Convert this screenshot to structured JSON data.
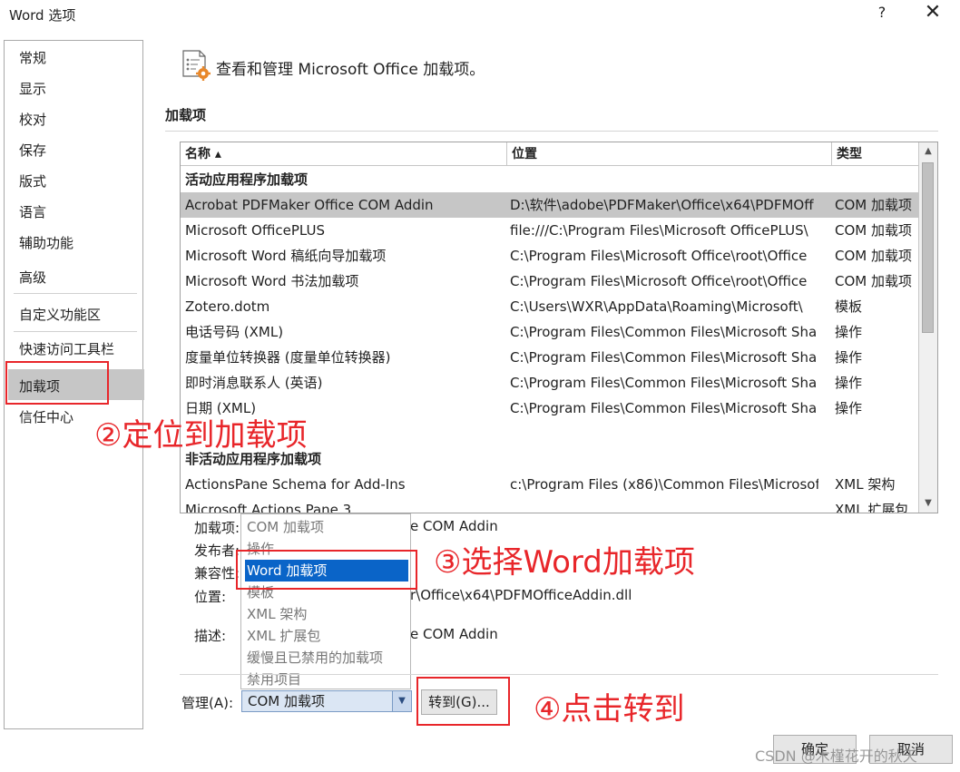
{
  "window": {
    "title": "Word 选项",
    "help": "?",
    "close": "✕"
  },
  "sidebar": {
    "items": [
      "常规",
      "显示",
      "校对",
      "保存",
      "版式",
      "语言",
      "辅助功能",
      "高级",
      "自定义功能区",
      "快速访问工具栏",
      "加载项",
      "信任中心"
    ],
    "selected": "加载项"
  },
  "header": {
    "text": "查看和管理 Microsoft Office 加载项。",
    "icon": "addin-gear-icon"
  },
  "section": {
    "label": "加载项"
  },
  "table": {
    "columns": [
      "名称 ▴",
      "位置",
      "类型"
    ],
    "groups": {
      "active": "活动应用程序加载项",
      "inactive": "非活动应用程序加载项"
    },
    "active_rows": [
      {
        "name": "Acrobat PDFMaker Office COM Addin",
        "location": "D:\\软件\\adobe\\PDFMaker\\Office\\x64\\PDFMOff",
        "type": "COM 加载项"
      },
      {
        "name": "Microsoft OfficePLUS",
        "location": "file:///C:\\Program Files\\Microsoft OfficePLUS\\",
        "type": "COM 加载项"
      },
      {
        "name": "Microsoft Word 稿纸向导加载项",
        "location": "C:\\Program Files\\Microsoft Office\\root\\Office",
        "type": "COM 加载项"
      },
      {
        "name": "Microsoft Word 书法加载项",
        "location": "C:\\Program Files\\Microsoft Office\\root\\Office",
        "type": "COM 加载项"
      },
      {
        "name": "Zotero.dotm",
        "location": "C:\\Users\\WXR\\AppData\\Roaming\\Microsoft\\",
        "type": "模板"
      },
      {
        "name": "电话号码 (XML)",
        "location": "C:\\Program Files\\Common Files\\Microsoft Sha",
        "type": "操作"
      },
      {
        "name": "度量单位转换器 (度量单位转换器)",
        "location": "C:\\Program Files\\Common Files\\Microsoft Sha",
        "type": "操作"
      },
      {
        "name": "即时消息联系人 (英语)",
        "location": "C:\\Program Files\\Common Files\\Microsoft Sha",
        "type": "操作"
      },
      {
        "name": "日期 (XML)",
        "location": "C:\\Program Files\\Common Files\\Microsoft Sha",
        "type": "操作"
      }
    ],
    "inactive_rows": [
      {
        "name": "ActionsPane Schema for Add-Ins",
        "location": "c:\\Program Files (x86)\\Common Files\\Microsof",
        "type": "XML 架构"
      },
      {
        "name": "Microsoft Actions Pane 3",
        "location": "",
        "type": "XML 扩展包"
      }
    ]
  },
  "details": {
    "addin_label": "加载项:",
    "addin_value": "e COM Addin",
    "publisher_label": "发布者:",
    "compat_label": "兼容性:",
    "location_label": "位置:",
    "location_value": "r\\Office\\x64\\PDFMOfficeAddin.dll",
    "desc_label": "描述:",
    "desc_value": "e COM Addin"
  },
  "dropdown": {
    "options": [
      "COM 加载项",
      "操作",
      "Word 加载项",
      "模板",
      "XML 架构",
      "XML 扩展包",
      "缓慢且已禁用的加载项",
      "禁用项目"
    ],
    "highlighted": "Word 加载项"
  },
  "manage": {
    "label": "管理(A):",
    "value": "COM 加载项",
    "go_button": "转到(G)..."
  },
  "footer": {
    "ok": "确定",
    "cancel": "取消"
  },
  "annotations": {
    "step2": "②定位到加载项",
    "step3": "③选择Word加载项",
    "step4": "④点击转到",
    "color": "#e8262a"
  },
  "watermark": "CSDN @木槿花开的秋天"
}
